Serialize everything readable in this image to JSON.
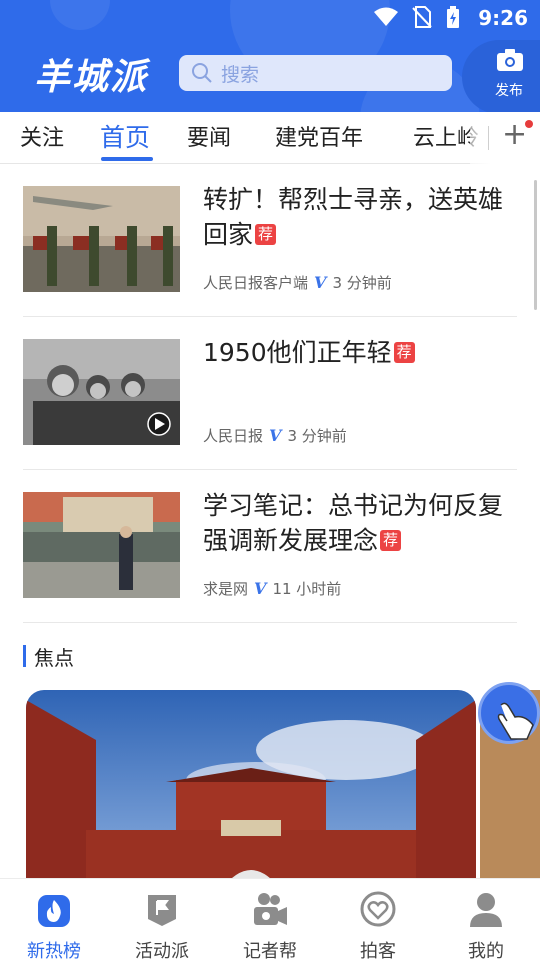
{
  "status_bar": {
    "time": "9:26"
  },
  "header": {
    "logo": "羊城派",
    "search_placeholder": "搜索",
    "publish_label": "发布"
  },
  "tabs": [
    {
      "label": "关注",
      "active": false
    },
    {
      "label": "首页",
      "active": true
    },
    {
      "label": "要闻",
      "active": false
    },
    {
      "label": "建党百年",
      "active": false
    },
    {
      "label": "云上岭",
      "active": false
    }
  ],
  "news": [
    {
      "title": "转扩！帮烈士寻亲，送英雄回家",
      "badge": "荐",
      "source": "人民日报客户端",
      "time": "3 分钟前"
    },
    {
      "title": "1950他们正年轻",
      "badge": "荐",
      "source": "人民日报",
      "time": "3 分钟前"
    },
    {
      "title": "学习笔记：总书记为何反复强调新发展理念",
      "badge": "荐",
      "source": "求是网",
      "time": "11 小时前"
    }
  ],
  "focus": {
    "title": "焦点"
  },
  "bottom_nav": [
    {
      "label": "新热榜",
      "icon": "flame-icon",
      "active": true
    },
    {
      "label": "活动派",
      "icon": "flag-icon",
      "active": false
    },
    {
      "label": "记者帮",
      "icon": "video-camera-icon",
      "active": false
    },
    {
      "label": "拍客",
      "icon": "heart-icon",
      "active": false
    },
    {
      "label": "我的",
      "icon": "user-icon",
      "active": false
    }
  ],
  "colors": {
    "brand": "#2f6bea",
    "badge": "#ec4343"
  }
}
